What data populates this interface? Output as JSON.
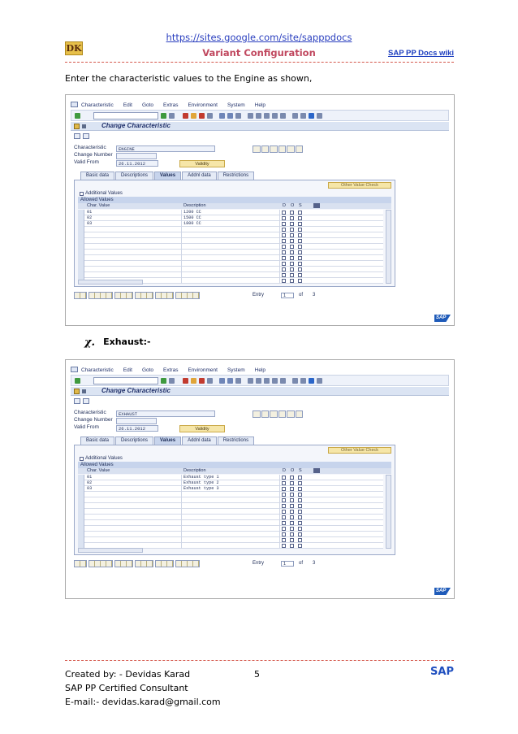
{
  "header": {
    "url": "https://sites.google.com/site/sapppdocs",
    "logo": "DK",
    "title": "Variant Configuration",
    "wiki_link": "SAP PP Docs wiki"
  },
  "intro_text": "Enter the characteristic values to the Engine as shown,",
  "section_bullet": {
    "symbol": "χ.",
    "label": "Exhaust:-"
  },
  "sap_menu": [
    "Characteristic",
    "Edit",
    "Goto",
    "Extras",
    "Environment",
    "System",
    "Help"
  ],
  "screen_title": "Change Characteristic",
  "field_labels": {
    "characteristic": "Characteristic",
    "change_number": "Change Number",
    "valid_from": "Valid From"
  },
  "validity_button": "Validity",
  "tabs": [
    "Basic data",
    "Descriptions",
    "Values",
    "Addnl data",
    "Restrictions"
  ],
  "active_tab": "Values",
  "other_value_check": "Other Value Check",
  "additional_values": "Additional Values",
  "allowed_values": "Allowed Values",
  "grid_headers": {
    "char_value": "Char. Value",
    "description": "Description",
    "d": "D",
    "o": "O",
    "s": "S"
  },
  "entry_label": "Entry",
  "of_label": "of",
  "sap_logo_small": "SAP",
  "screen1": {
    "characteristic": "ENGINE",
    "valid_from": "26.11.2012",
    "entry": "1",
    "total": "3",
    "rows": [
      {
        "value": "01",
        "description": "1200 CC"
      },
      {
        "value": "02",
        "description": "1500 CC"
      },
      {
        "value": "03",
        "description": "1800 CC"
      }
    ]
  },
  "screen2": {
    "characteristic": "EXHAUST",
    "valid_from": "26.11.2012",
    "entry": "1",
    "total": "3",
    "rows": [
      {
        "value": "01",
        "description": "Exhaust type 1"
      },
      {
        "value": "02",
        "description": "Exhaust type 2"
      },
      {
        "value": "03",
        "description": "Exhaust type 3"
      }
    ]
  },
  "footer": {
    "created_by": "Created by: - Devidas Karad",
    "role": "SAP PP Certified Consultant",
    "email": "E-mail:- devidas.karad@gmail.com",
    "page_number": "5",
    "sap_brand": "SAP"
  }
}
